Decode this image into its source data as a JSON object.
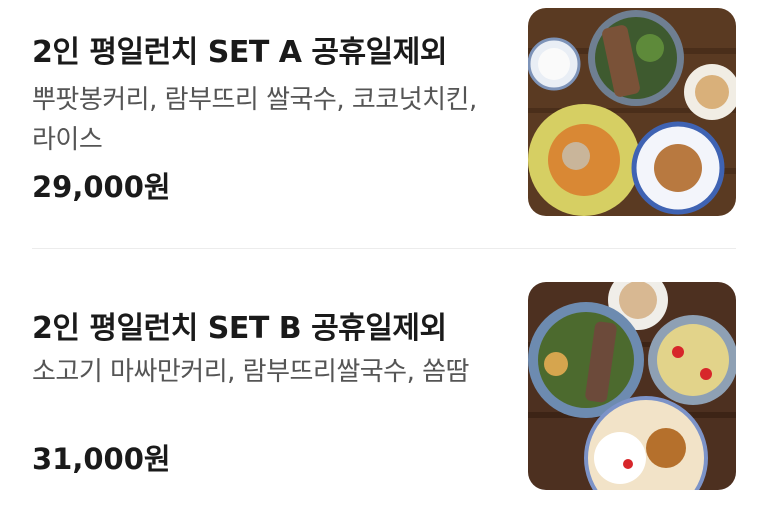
{
  "menu": {
    "items": [
      {
        "title": "2인 평일런치 SET A 공휴일제외",
        "description": "뿌팟봉커리, 람부뜨리 쌀국수, 코코넛치킨, 라이스",
        "price": "29,000원",
        "image_icon": "food-photo-icon"
      },
      {
        "title": "2인 평일런치 SET B 공휴일제외",
        "description": "소고기 마싸만커리, 람부뜨리쌀국수, 쏨땀",
        "price": "31,000원",
        "image_icon": "food-photo-icon"
      }
    ]
  },
  "colors": {
    "text": "#1a1a1a",
    "secondary_text": "#555555",
    "divider": "#ececec"
  }
}
